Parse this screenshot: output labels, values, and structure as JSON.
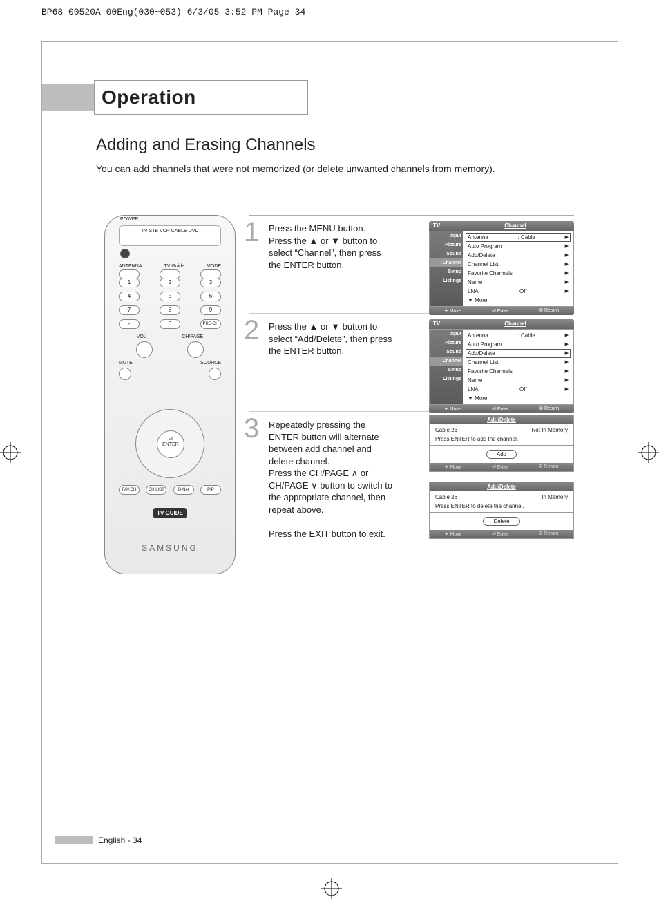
{
  "header_line": "BP68-00520A-00Eng(030~053)  6/3/05  3:52 PM  Page 34",
  "section_title": "Operation",
  "subtitle": "Adding and Erasing Channels",
  "intro": "You can add channels that were not memorized (or delete unwanted channels from memory).",
  "remote": {
    "top_labels": "TV  STB  VCR  CABLE  DVD",
    "power": "POWER",
    "row_labels": {
      "antenna": "ANTENNA",
      "tvguide": "TV Guide",
      "mode": "MODE"
    },
    "nums": [
      "1",
      "2",
      "3",
      "4",
      "5",
      "6",
      "7",
      "8",
      "9",
      "-",
      "0",
      "PRE-CH"
    ],
    "mid_labels": {
      "vol": "VOL",
      "chpage": "CH/PAGE",
      "mute": "MUTE",
      "source": "SOURCE"
    },
    "enter": "ENTER",
    "bottom_row": [
      "FAV.CH",
      "CH.LIST",
      "D-Net",
      "PIP"
    ],
    "brand": "SAMSUNG",
    "tvguide_logo": "TV GUIDE"
  },
  "steps": [
    {
      "num": "1",
      "text": "Press the MENU button.\nPress the ▲ or ▼ button to select “Channel”, then press the ENTER button."
    },
    {
      "num": "2",
      "text": "Press the ▲ or ▼ button to select “Add/Delete”, then press the ENTER button."
    },
    {
      "num": "3",
      "text": "Repeatedly pressing the ENTER button will alternate between add channel and delete channel.\nPress the CH/PAGE ∧ or CH/PAGE ∨ button to switch to the appropriate channel, then repeat above.\n\nPress the EXIT button to exit."
    }
  ],
  "menu": {
    "corner": "TV",
    "title": "Channel",
    "side": [
      "Input",
      "Picture",
      "Sound",
      "Channel",
      "Setup",
      "Listings"
    ],
    "rows": [
      {
        "label": "Antenna",
        "value": ": Cable"
      },
      {
        "label": "Auto Program",
        "value": ""
      },
      {
        "label": "Add/Delete",
        "value": ""
      },
      {
        "label": "Channel List",
        "value": ""
      },
      {
        "label": "Favorite Channels",
        "value": ""
      },
      {
        "label": "Name",
        "value": ""
      },
      {
        "label": "LNA",
        "value": ": Off"
      },
      {
        "label": "▼ More",
        "value": "",
        "noarrow": true
      }
    ],
    "bottom": [
      "✦ Move",
      "⏎ Enter",
      "⦾ Return"
    ]
  },
  "addDelete": {
    "title": "Add/Delete",
    "channel_label": "Cable   26",
    "not_in": "Not In Memory",
    "in_mem": "In Memory",
    "add_prompt": "Press ENTER to add the channel.",
    "del_prompt": "Press ENTER to delete the channel.",
    "add_btn": "Add",
    "del_btn": "Delete",
    "bottom": [
      "✦ Move",
      "⏎ Enter",
      "⦾ Return"
    ]
  },
  "footer": "English - 34"
}
